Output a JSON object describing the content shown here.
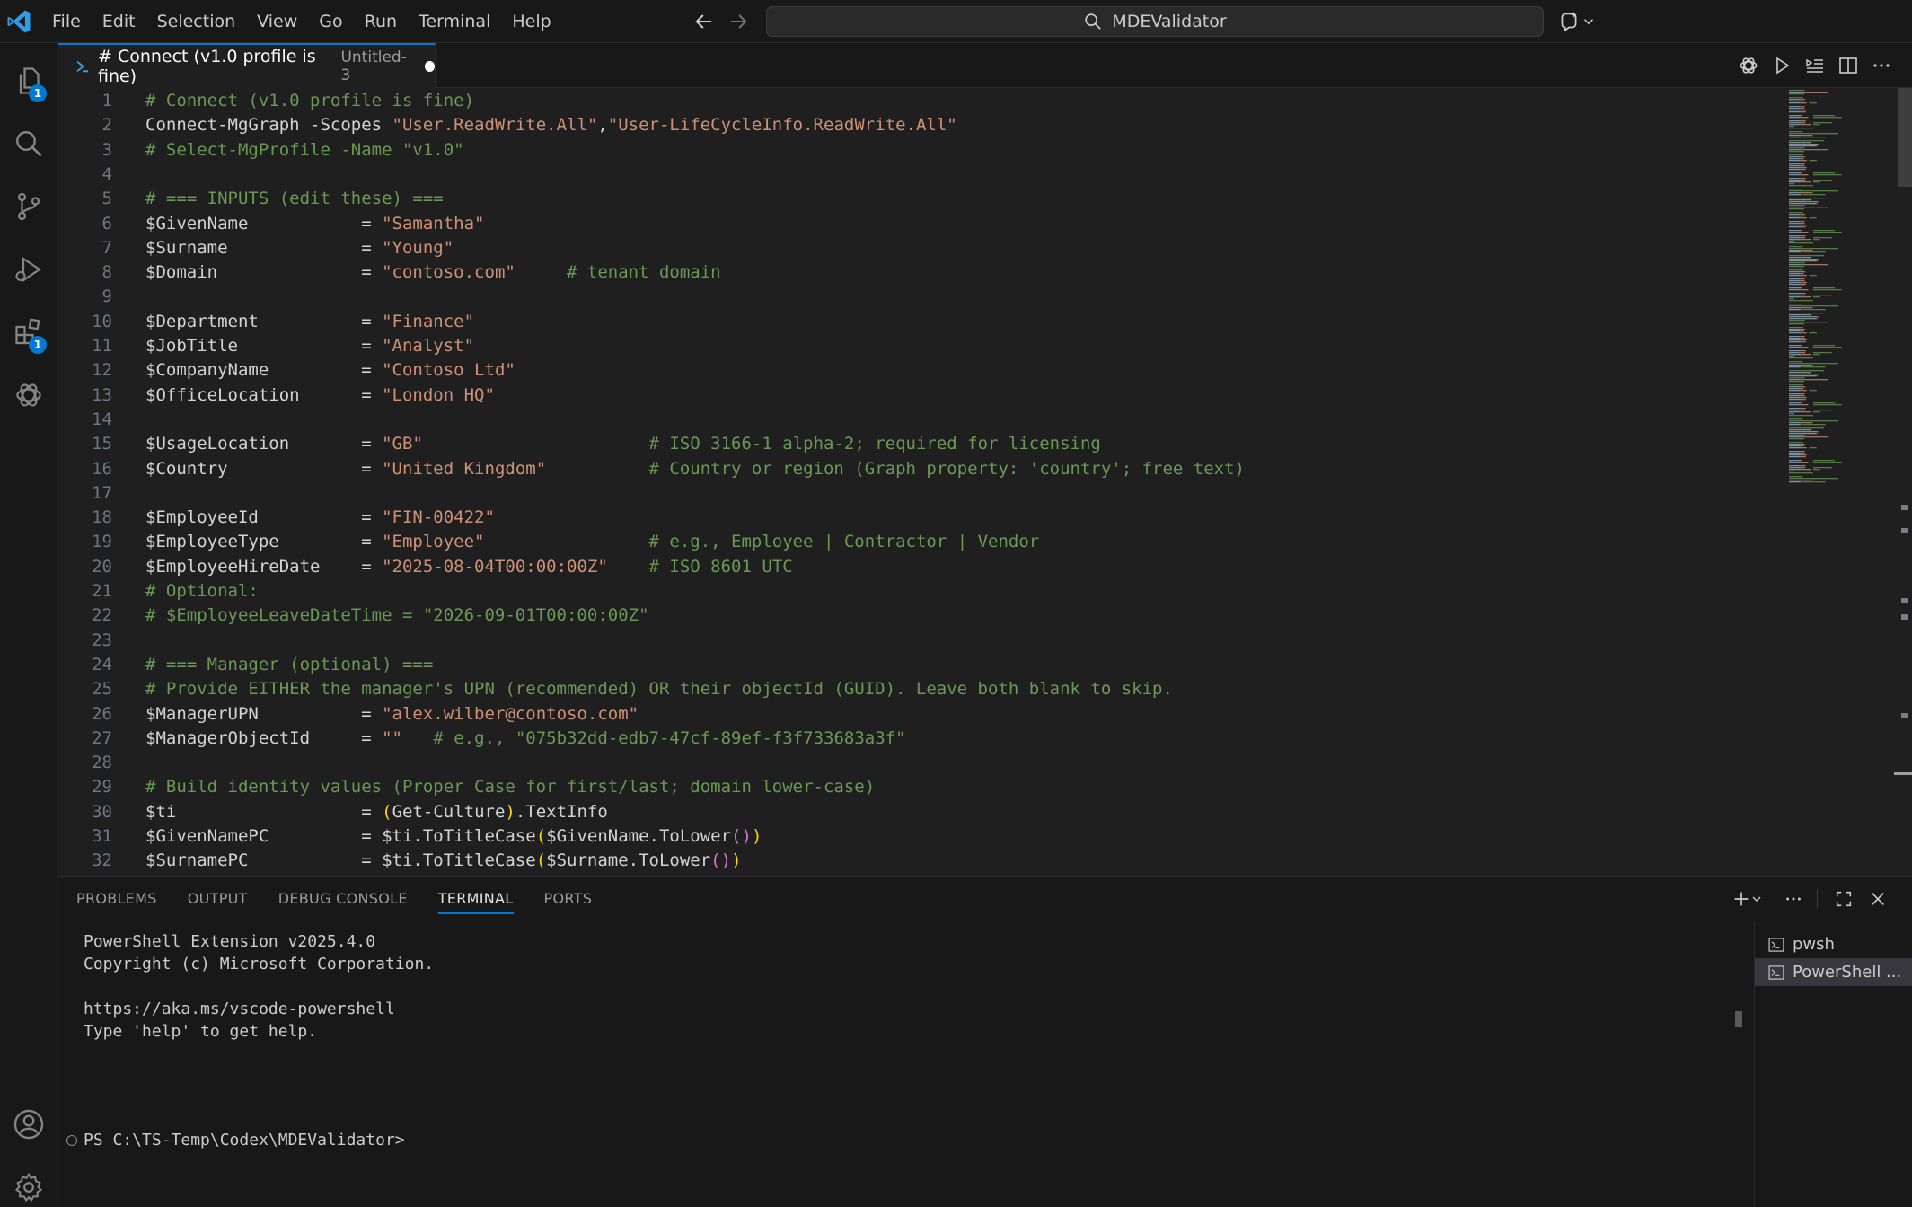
{
  "menubar": {
    "items": [
      "File",
      "Edit",
      "Selection",
      "View",
      "Go",
      "Run",
      "Terminal",
      "Help"
    ]
  },
  "search": {
    "text": "MDEValidator"
  },
  "activitybar": {
    "explorer_badge": "1",
    "extensions_badge": "1"
  },
  "tab": {
    "title": "# Connect (v1.0 profile is fine)",
    "description": "Untitled-3"
  },
  "editor": {
    "lines": [
      {
        "n": "1",
        "tokens": [
          [
            "cmt",
            "# Connect (v1.0 profile is fine)"
          ]
        ]
      },
      {
        "n": "2",
        "tokens": [
          [
            "pln",
            "Connect-MgGraph -Scopes "
          ],
          [
            "str",
            "\"User.ReadWrite.All\""
          ],
          [
            "pln",
            ","
          ],
          [
            "str",
            "\"User-LifeCycleInfo.ReadWrite.All\""
          ]
        ]
      },
      {
        "n": "3",
        "tokens": [
          [
            "cmt",
            "# Select-MgProfile -Name \"v1.0\""
          ]
        ]
      },
      {
        "n": "4",
        "tokens": []
      },
      {
        "n": "5",
        "tokens": [
          [
            "cmt",
            "# === INPUTS (edit these) ==="
          ]
        ]
      },
      {
        "n": "6",
        "tokens": [
          [
            "pln",
            "$GivenName           = "
          ],
          [
            "str",
            "\"Samantha\""
          ]
        ]
      },
      {
        "n": "7",
        "tokens": [
          [
            "pln",
            "$Surname             = "
          ],
          [
            "str",
            "\"Young\""
          ]
        ]
      },
      {
        "n": "8",
        "tokens": [
          [
            "pln",
            "$Domain              = "
          ],
          [
            "str",
            "\"contoso.com\""
          ],
          [
            "pln",
            "     "
          ],
          [
            "cmt",
            "# tenant domain"
          ]
        ]
      },
      {
        "n": "9",
        "tokens": []
      },
      {
        "n": "10",
        "tokens": [
          [
            "pln",
            "$Department          = "
          ],
          [
            "str",
            "\"Finance\""
          ]
        ]
      },
      {
        "n": "11",
        "tokens": [
          [
            "pln",
            "$JobTitle            = "
          ],
          [
            "str",
            "\"Analyst\""
          ]
        ]
      },
      {
        "n": "12",
        "tokens": [
          [
            "pln",
            "$CompanyName         = "
          ],
          [
            "str",
            "\"Contoso Ltd\""
          ]
        ]
      },
      {
        "n": "13",
        "tokens": [
          [
            "pln",
            "$OfficeLocation      = "
          ],
          [
            "str",
            "\"London HQ\""
          ]
        ]
      },
      {
        "n": "14",
        "tokens": []
      },
      {
        "n": "15",
        "tokens": [
          [
            "pln",
            "$UsageLocation       = "
          ],
          [
            "str",
            "\"GB\""
          ],
          [
            "pln",
            "                      "
          ],
          [
            "cmt",
            "# ISO 3166-1 alpha-2; required for licensing"
          ]
        ]
      },
      {
        "n": "16",
        "tokens": [
          [
            "pln",
            "$Country             = "
          ],
          [
            "str",
            "\"United Kingdom\""
          ],
          [
            "pln",
            "          "
          ],
          [
            "cmt",
            "# Country or region (Graph property: 'country'; free text)"
          ]
        ]
      },
      {
        "n": "17",
        "tokens": []
      },
      {
        "n": "18",
        "tokens": [
          [
            "pln",
            "$EmployeeId          = "
          ],
          [
            "str",
            "\"FIN-00422\""
          ]
        ]
      },
      {
        "n": "19",
        "tokens": [
          [
            "pln",
            "$EmployeeType        = "
          ],
          [
            "str",
            "\"Employee\""
          ],
          [
            "pln",
            "                "
          ],
          [
            "cmt",
            "# e.g., Employee | Contractor | Vendor"
          ]
        ]
      },
      {
        "n": "20",
        "tokens": [
          [
            "pln",
            "$EmployeeHireDate    = "
          ],
          [
            "str",
            "\"2025-08-04T00:00:00Z\""
          ],
          [
            "pln",
            "    "
          ],
          [
            "cmt",
            "# ISO 8601 UTC"
          ]
        ]
      },
      {
        "n": "21",
        "tokens": [
          [
            "cmt",
            "# Optional:"
          ]
        ]
      },
      {
        "n": "22",
        "tokens": [
          [
            "cmt",
            "# $EmployeeLeaveDateTime = \"2026-09-01T00:00:00Z\""
          ]
        ]
      },
      {
        "n": "23",
        "tokens": []
      },
      {
        "n": "24",
        "tokens": [
          [
            "cmt",
            "# === Manager (optional) ==="
          ]
        ]
      },
      {
        "n": "25",
        "tokens": [
          [
            "cmt",
            "# Provide EITHER the manager's UPN (recommended) OR their objectId (GUID). Leave both blank to skip."
          ]
        ]
      },
      {
        "n": "26",
        "tokens": [
          [
            "pln",
            "$ManagerUPN          = "
          ],
          [
            "str",
            "\"alex.wilber@contoso.com\""
          ]
        ]
      },
      {
        "n": "27",
        "tokens": [
          [
            "pln",
            "$ManagerObjectId     = "
          ],
          [
            "str",
            "\"\""
          ],
          [
            "pln",
            "   "
          ],
          [
            "cmt",
            "# e.g., \"075b32dd-edb7-47cf-89ef-f3f733683a3f\""
          ]
        ]
      },
      {
        "n": "28",
        "tokens": []
      },
      {
        "n": "29",
        "tokens": [
          [
            "cmt",
            "# Build identity values (Proper Case for first/last; domain lower-case)"
          ]
        ]
      },
      {
        "n": "30",
        "tokens": [
          [
            "pln",
            "$ti                  = "
          ],
          [
            "br1",
            "("
          ],
          [
            "pln",
            "Get-Culture"
          ],
          [
            "br1",
            ")"
          ],
          [
            "pln",
            ".TextInfo"
          ]
        ]
      },
      {
        "n": "31",
        "tokens": [
          [
            "pln",
            "$GivenNamePC         = $ti.ToTitleCase"
          ],
          [
            "br1",
            "("
          ],
          [
            "pln",
            "$GivenName.ToLower"
          ],
          [
            "br2",
            "()"
          ],
          [
            "br1",
            ")"
          ]
        ]
      },
      {
        "n": "32",
        "tokens": [
          [
            "pln",
            "$SurnamePC           = $ti.ToTitleCase"
          ],
          [
            "br1",
            "("
          ],
          [
            "pln",
            "$Surname.ToLower"
          ],
          [
            "br2",
            "()"
          ],
          [
            "br1",
            ")"
          ]
        ]
      }
    ]
  },
  "panel": {
    "tabs": [
      "PROBLEMS",
      "OUTPUT",
      "DEBUG CONSOLE",
      "TERMINAL",
      "PORTS"
    ],
    "active_tab": "TERMINAL",
    "terminal_lines": [
      "PowerShell Extension v2025.4.0",
      "Copyright (c) Microsoft Corporation.",
      "",
      "https://aka.ms/vscode-powershell",
      "Type 'help' to get help.",
      "",
      "PS C:\\TS-Temp\\Codex\\MDEValidator>"
    ],
    "terminal_instances": [
      "pwsh",
      "PowerShell ..."
    ],
    "selected_instance": 1
  },
  "colors": {
    "accent": "#0078d4",
    "comment": "#6a9955",
    "string": "#ce9178",
    "variable": "#9cdcfe",
    "command": "#dcdcaa"
  }
}
